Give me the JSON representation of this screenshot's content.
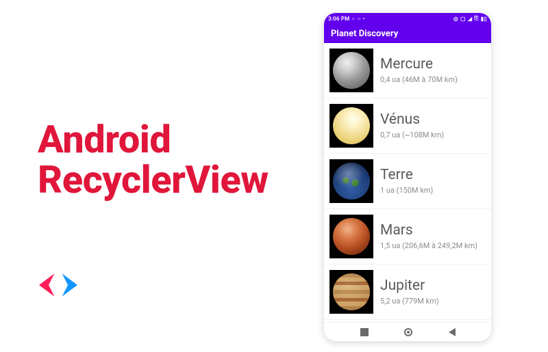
{
  "hero": {
    "line1": "Android",
    "line2": "RecyclerView"
  },
  "status": {
    "time": "3:06 PM",
    "left_glyphs": [
      "○",
      "○",
      "•"
    ],
    "right_glyphs": [
      "◎",
      "▢",
      "◢",
      "⎘",
      "▮▯"
    ]
  },
  "app": {
    "title": "Planet Discovery",
    "rows": [
      {
        "name": "Mercure",
        "sub": "0,4 ua (46M à 70M km)",
        "planet_class": "mercury"
      },
      {
        "name": "Vénus",
        "sub": "0,7 ua (~108M km)",
        "planet_class": "venus"
      },
      {
        "name": "Terre",
        "sub": "1 ua (150M km)",
        "planet_class": "earth"
      },
      {
        "name": "Mars",
        "sub": "1,5 ua (206,6M à 249,2M km)",
        "planet_class": "mars"
      },
      {
        "name": "Jupiter",
        "sub": "5,2 ua (779M km)",
        "planet_class": "jupiter"
      }
    ]
  }
}
